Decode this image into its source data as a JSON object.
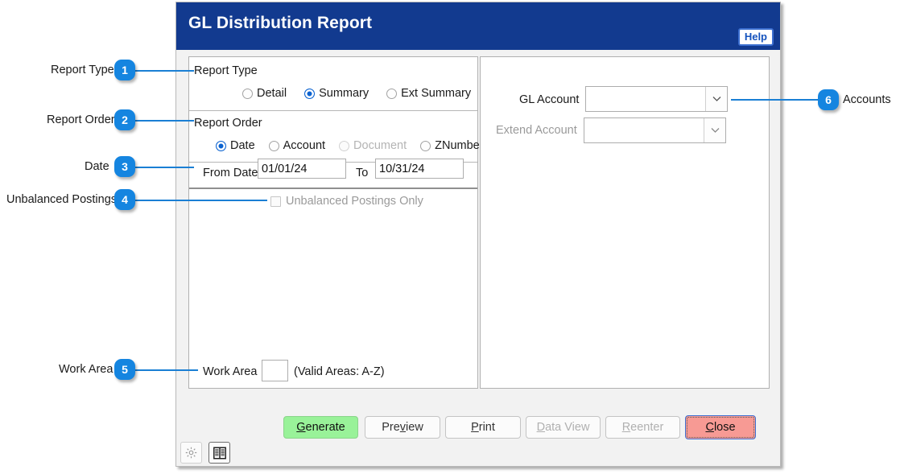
{
  "window": {
    "title": "GL Distribution Report",
    "help_label": "Help"
  },
  "report_type": {
    "group_label": "Report Type",
    "options": [
      {
        "label": "Detail",
        "selected": false,
        "disabled": false
      },
      {
        "label": "Summary",
        "selected": true,
        "disabled": false
      },
      {
        "label": "Ext Summary",
        "selected": false,
        "disabled": false
      }
    ]
  },
  "report_order": {
    "group_label": "Report Order",
    "options": [
      {
        "label": "Date",
        "selected": true,
        "disabled": false
      },
      {
        "label": "Account",
        "selected": false,
        "disabled": false
      },
      {
        "label": "Document",
        "selected": false,
        "disabled": true
      },
      {
        "label": "ZNumber",
        "selected": false,
        "disabled": false
      }
    ]
  },
  "date_range": {
    "from_label": "From Date",
    "from_value": "01/01/24",
    "to_label": "To",
    "to_value": "10/31/24"
  },
  "unbalanced": {
    "label": "Unbalanced Postings Only",
    "checked": false,
    "disabled": true
  },
  "work_area": {
    "label": "Work Area",
    "value": "",
    "hint": "(Valid Areas: A-Z)"
  },
  "accounts": {
    "gl_account_label": "GL Account",
    "gl_account_value": "",
    "extend_account_label": "Extend Account",
    "extend_account_value": ""
  },
  "buttons": [
    {
      "label": "Generate",
      "accel": "G",
      "state": "primary"
    },
    {
      "label": "Preview",
      "accel": "v",
      "state": "normal"
    },
    {
      "label": "Print",
      "accel": "P",
      "state": "normal"
    },
    {
      "label": "Data View",
      "accel": "D",
      "state": "disabled"
    },
    {
      "label": "Reenter",
      "accel": "R",
      "state": "disabled"
    },
    {
      "label": "Close",
      "accel": "C",
      "state": "danger"
    }
  ],
  "toolbar": {
    "settings_icon": "gear-icon",
    "layout_icon": "book-columns-icon"
  },
  "annotations": [
    {
      "number": "1",
      "label": "Report Type"
    },
    {
      "number": "2",
      "label": "Report Order"
    },
    {
      "number": "3",
      "label": "Date"
    },
    {
      "number": "4",
      "label": "Unbalanced Postings"
    },
    {
      "number": "5",
      "label": "Work Area"
    },
    {
      "number": "6",
      "label": "Accounts"
    }
  ],
  "colors": {
    "titlebar": "#123a8f",
    "badge": "#1585e0",
    "leader": "#1a7fd4",
    "generate": "#99f299",
    "close": "#f79a94"
  }
}
